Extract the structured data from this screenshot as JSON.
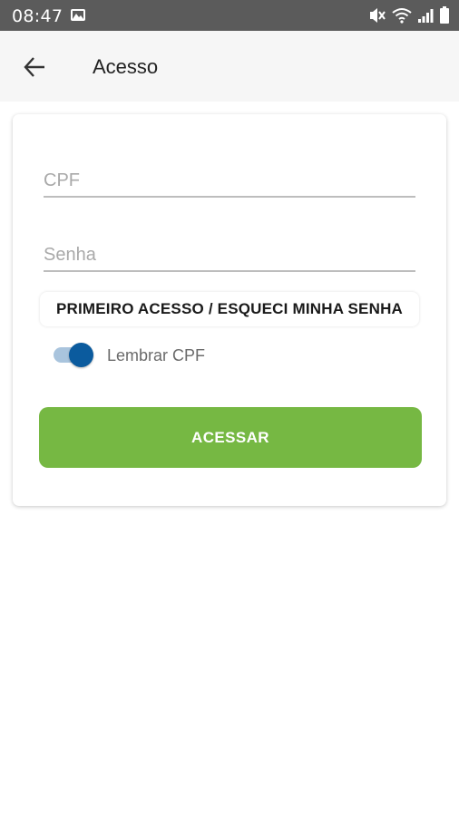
{
  "status_bar": {
    "time": "08:47",
    "icons": [
      "gallery-icon",
      "mute-icon",
      "wifi-icon",
      "signal-icon",
      "battery-icon"
    ]
  },
  "app_bar": {
    "back_icon": "arrow-left-icon",
    "title": "Acesso"
  },
  "form": {
    "cpf_placeholder": "CPF",
    "password_placeholder": "Senha",
    "first_access_label": "PRIMEIRO ACESSO / ESQUECI MINHA SENHA",
    "remember_label": "Lembrar CPF",
    "remember_on": true,
    "submit_label": "ACESSAR"
  },
  "colors": {
    "status_bar": "#5b5b5b",
    "app_bar": "#f6f6f6",
    "toggle_thumb": "#0b5b9e",
    "toggle_track": "#a9c4dd",
    "primary_button": "#76b843"
  }
}
